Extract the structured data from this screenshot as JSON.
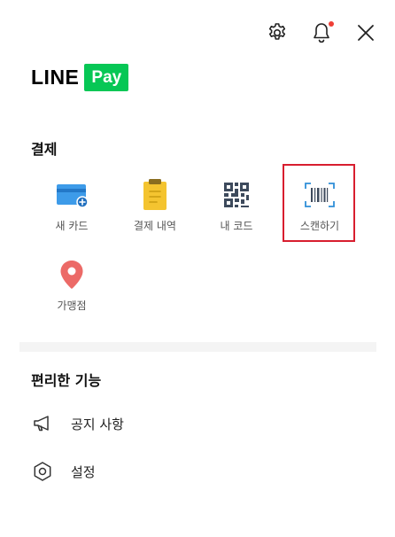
{
  "logo": {
    "line": "LINE",
    "pay": "Pay"
  },
  "payment": {
    "title": "결제",
    "items": [
      {
        "label": "새 카드"
      },
      {
        "label": "결제 내역"
      },
      {
        "label": "내 코드"
      },
      {
        "label": "스캔하기"
      },
      {
        "label": "가맹점"
      }
    ]
  },
  "features": {
    "title": "편리한 기능",
    "items": [
      {
        "label": "공지 사항"
      },
      {
        "label": "설정"
      }
    ]
  },
  "colors": {
    "brand": "#06c755",
    "highlight": "#d81e2f",
    "notification": "#ef3e36"
  }
}
